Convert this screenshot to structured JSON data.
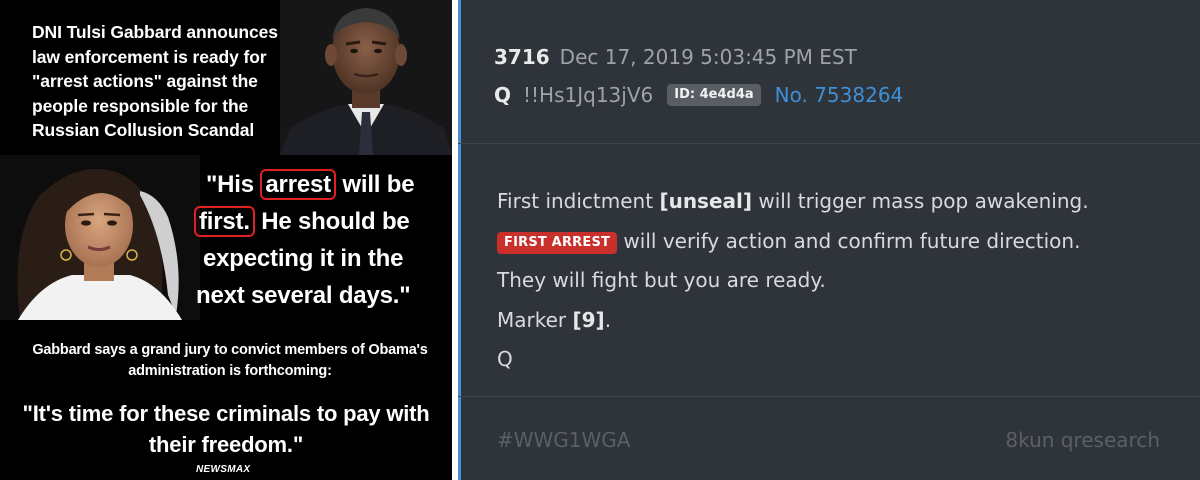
{
  "meme": {
    "headline_lines": [
      "DNI Tulsi Gabbard announces",
      "law enforcement is ready for",
      "\"arrest actions\" against the",
      "people responsible for the",
      "Russian Collusion Scandal"
    ],
    "quote": {
      "l1_pre": "\"His ",
      "l1_boxed": "arrest",
      "l1_post": " will be",
      "l2_boxed": "first.",
      "l2_post": " He should be",
      "l3": "expecting it in the",
      "l4": "next several days.\""
    },
    "jury_lines": [
      "Gabbard says a grand jury to convict members of Obama's",
      "administration is forthcoming:"
    ],
    "bigquote_lines": [
      "\"It's time for these criminals to pay with",
      "their freedom.\""
    ],
    "network": "NEWSMAX",
    "box_color": "#e02020"
  },
  "post": {
    "number": "3716",
    "date": "Dec 17, 2019 5:03:45 PM EST",
    "name": "Q",
    "tripcode": "!!Hs1Jq13jV6",
    "id_badge": "ID: 4e4d4a",
    "post_no": "No. 7538264",
    "body": {
      "line1_pre": "First indictment ",
      "line1_bold": "[unseal]",
      "line1_post": " will trigger mass pop awakening.",
      "line2_badge": "FIRST ARREST",
      "line2_post": " will verify action and confirm future direction.",
      "line3": "They will fight but you are ready.",
      "line4_pre": "Marker ",
      "line4_bold": "[9]",
      "line4_post": ".",
      "line5": "Q"
    },
    "hashtag": "#WWG1WGA",
    "source": "8kun qresearch",
    "colors": {
      "background": "#2f333a",
      "link": "#3e8fd5",
      "badge_red": "#c9302c",
      "accent_edge": "#4a8fd8"
    }
  }
}
